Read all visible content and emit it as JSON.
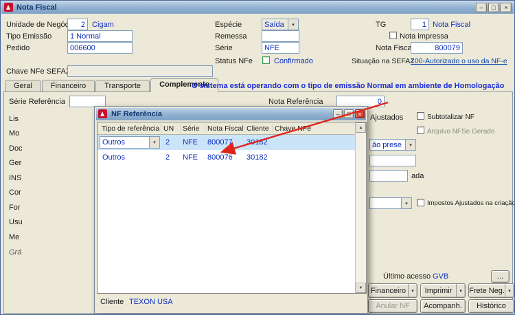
{
  "window": {
    "title": "Nota Fiscal"
  },
  "icons": {
    "dropdown": "▾",
    "scroll_up": "▲",
    "scroll_down": "▼",
    "minimize": "–",
    "maximize": "□",
    "close": "×"
  },
  "form": {
    "labels": {
      "unidade": "Unidade de Negócio",
      "tipo_emissao": "Tipo Emissão",
      "pedido": "Pedido",
      "especie": "Espécie",
      "remessa": "Remessa",
      "serie": "Série",
      "status_nfe": "Status NFe",
      "tg": "TG",
      "nota_impressa": "Nota impressa",
      "nota_fiscal": "Nota Fiscal",
      "situacao": "Situação na SEFAZ",
      "chave": "Chave NFe SEFAZ"
    },
    "values": {
      "unidade": "2",
      "unidade_desc": "Cigam",
      "tipo_emissao": "1 Normal",
      "pedido": "006600",
      "especie": "Saída",
      "remessa": "",
      "serie": "NFE",
      "status_nfe": "Confirmado",
      "tg": "1",
      "tg_desc": "Nota Fiscal",
      "nota_fiscal": "800079",
      "situacao_link": "100-Autorizado o uso da NF-e",
      "chave": ""
    }
  },
  "tabs": {
    "items": [
      "Geral",
      "Financeiro",
      "Transporte",
      "Complemento"
    ],
    "active": "Complemento",
    "message": "O sistema está operando com o tipo de emissão Normal em ambiente de Homologação"
  },
  "comp": {
    "serie_ref_label": "Série Referência",
    "serie_ref_value": "",
    "nota_ref_label": "Nota Referência",
    "nota_ref_value": "0",
    "left_labels": [
      "Lis",
      "Mo",
      "Doc",
      "Ger",
      "INS",
      "Cor",
      "For",
      "Usu",
      "Me",
      "Grá"
    ],
    "right": {
      "ajustados_fragment": "Ajustados",
      "subtotalizar": "Subtotalizar NF",
      "arquivo_nfse": "Arquivo NFSe Gerado",
      "combo_fragment": "ão prese",
      "ada_fragment": "ada",
      "impostos_criacao": "Impostos Ajustados na criação",
      "ultimo_acesso": "Último acesso",
      "ultimo_acesso_value": "GVB",
      "more": "..."
    },
    "buttons": {
      "financeiro": "Financeiro",
      "imprimir": "Imprimir",
      "frete": "Frete Neg.",
      "anular": "Anular NF",
      "acompanh": "Acompanh.",
      "historico": "Histórico"
    }
  },
  "modal": {
    "title": "NF Referência",
    "columns": [
      "Tipo de referência",
      "UN",
      "Série",
      "Nota Fiscal",
      "Cliente",
      "Chave NFe"
    ],
    "rows": [
      {
        "tipo": "Outros",
        "un": "2",
        "serie": "NFE",
        "nota": "800077",
        "cliente": "30182",
        "chave": ""
      },
      {
        "tipo": "Outros",
        "un": "2",
        "serie": "NFE",
        "nota": "800076",
        "cliente": "30182",
        "chave": ""
      }
    ],
    "footer": {
      "cliente_label": "Cliente",
      "cliente_value": "TEXON USA"
    }
  },
  "colors": {
    "value_blue": "#0B2FBE",
    "link_blue": "#0645AD",
    "homolog_blue": "#1B2BD4",
    "annotation_red": "#E0241B",
    "titlebar_blue": "#8FB0CF",
    "selected_row": "#CCE4F8",
    "background": "#ECE9D8"
  }
}
